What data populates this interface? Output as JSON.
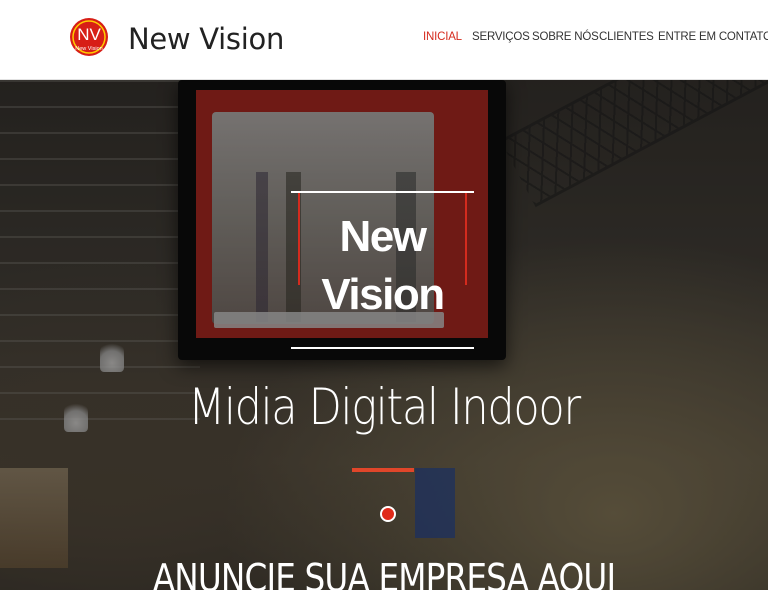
{
  "brand": {
    "badge": "NV",
    "badge_small": "New Vision",
    "name": "New Vision",
    "accent_color": "#d52b1e"
  },
  "nav": {
    "items": [
      {
        "label": "INICIAL",
        "active": true
      },
      {
        "label": "SERVIÇOS",
        "active": false
      },
      {
        "label": "SOBRE NÓS",
        "active": false
      },
      {
        "label": "CLIENTES",
        "active": false
      },
      {
        "label": "ENTRE EM CONTATO",
        "active": false
      }
    ]
  },
  "hero": {
    "title_line1": "New",
    "title_line2": "Vision",
    "subtitle": "Midia Digital Indoor",
    "cta": "ANUNCIE SUA EMPRESA AQUI"
  }
}
